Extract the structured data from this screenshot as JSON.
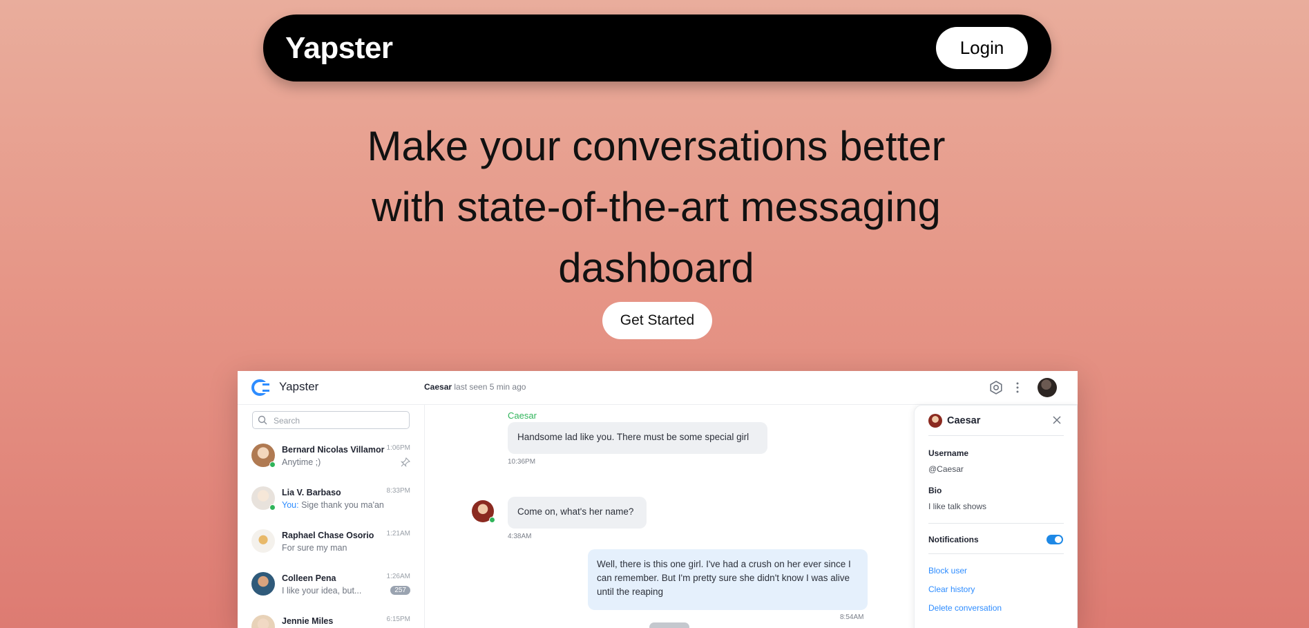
{
  "nav": {
    "brand": "Yapster",
    "login_label": "Login"
  },
  "hero": {
    "headline_line1": "Make your conversations better",
    "headline_line2": "with state-of-the-art messaging",
    "headline_line3": "dashboard",
    "cta_label": "Get Started"
  },
  "app": {
    "name": "Yapster",
    "header": {
      "contact": "Caesar",
      "status": "last seen 5 min ago"
    },
    "search": {
      "placeholder": "Search"
    },
    "chats": [
      {
        "name": "Bernard Nicolas Villamor",
        "message": "Anytime ;)",
        "time": "1:06PM",
        "online": true,
        "pinned": true
      },
      {
        "name": "Lia V. Barbaso",
        "you_prefix": "You:",
        "message": "Sige thank you ma'an",
        "time": "8:33PM",
        "online": true
      },
      {
        "name": "Raphael Chase Osorio",
        "message": "For sure my man",
        "time": "1:21AM"
      },
      {
        "name": "Colleen Pena",
        "message": "I like your idea, but...",
        "time": "1:26AM",
        "badge": "257"
      },
      {
        "name": "Jennie Miles",
        "time": "6:15PM"
      }
    ],
    "conversation": {
      "sender": "Caesar",
      "messages": [
        {
          "text": "Handsome lad like you. There must be some special girl",
          "time": "10:36PM"
        },
        {
          "text": "Come on, what's her name?",
          "time": "4:38AM"
        },
        {
          "text": "Well, there is this one girl. I've had a crush on her ever since I can remember. But I'm pretty sure she didn't know I was alive until the reaping",
          "time": "8:54AM"
        }
      ]
    },
    "panel": {
      "name": "Caesar",
      "username_label": "Username",
      "username": "@Caesar",
      "bio_label": "Bio",
      "bio": "I like talk shows",
      "notifications_label": "Notifications",
      "notifications_on": true,
      "links": {
        "block": "Block user",
        "clear": "Clear history",
        "delete": "Delete conversation"
      }
    }
  },
  "colors": {
    "accent": "#2d8cff",
    "online": "#2fb45a",
    "toggle": "#1e88e5"
  }
}
